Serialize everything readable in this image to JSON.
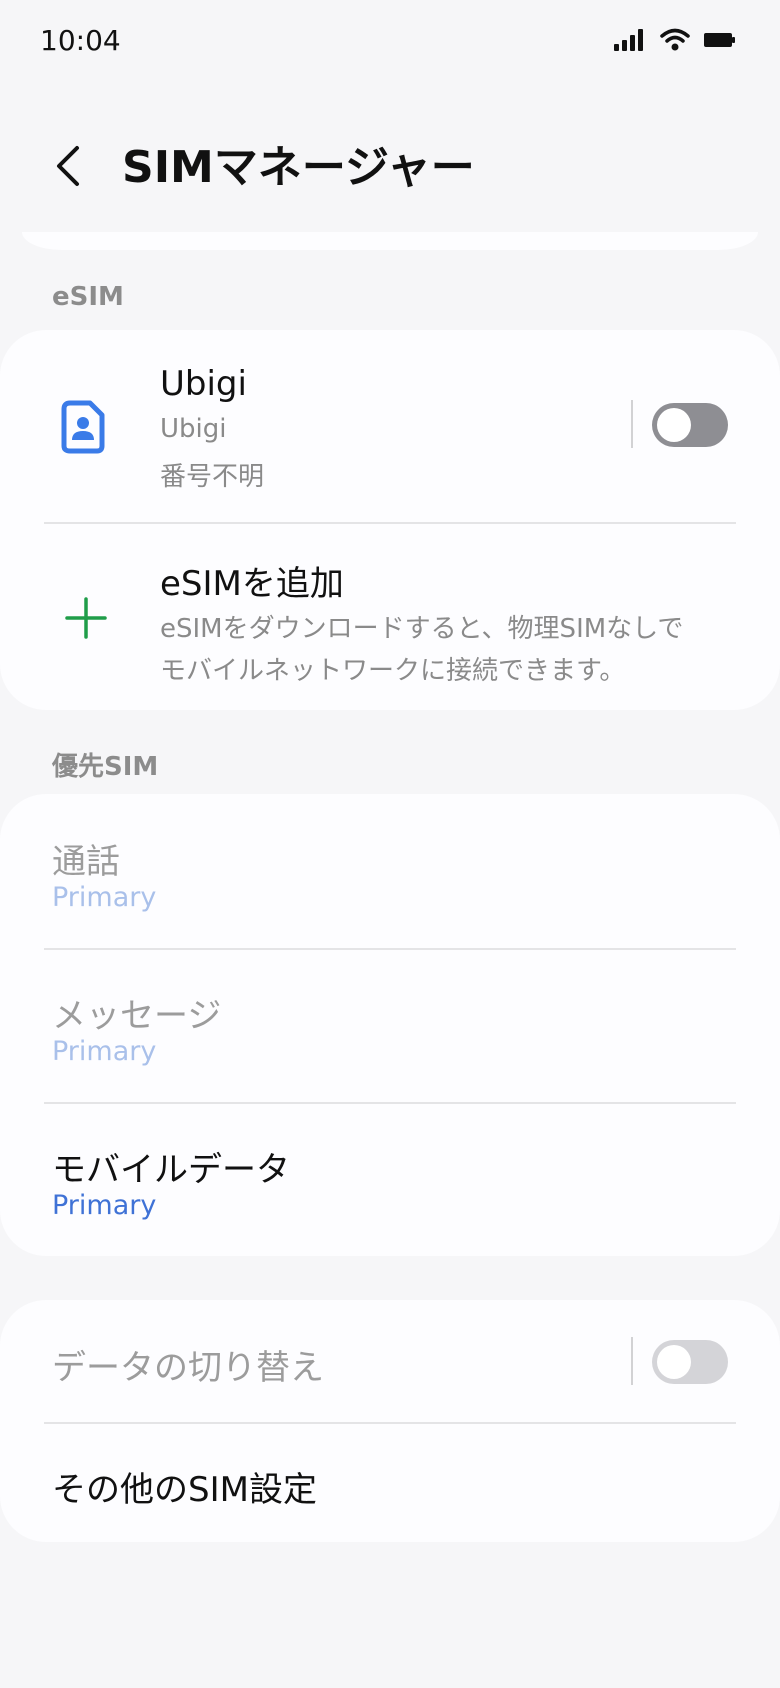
{
  "status_bar": {
    "time": "10:04",
    "icons": [
      "signal-icon",
      "wifi-icon",
      "battery-icon"
    ]
  },
  "header": {
    "title": "SIMマネージャー",
    "back_icon": "chevron-left-icon"
  },
  "esim_section": {
    "label": "eSIM",
    "sim": {
      "title": "Ubigi",
      "carrier": "Ubigi",
      "number": "番号不明",
      "icon": "sim-card-icon",
      "enabled": false
    },
    "add": {
      "title": "eSIMを追加",
      "description_line1": "eSIMをダウンロードすると、物理SIMなしで",
      "description_line2": "モバイルネットワークに接続できます。",
      "icon": "plus-icon"
    }
  },
  "preferred_section": {
    "label": "優先SIM",
    "items": [
      {
        "title": "通話",
        "value": "Primary",
        "enabled": false
      },
      {
        "title": "メッセージ",
        "value": "Primary",
        "enabled": false
      },
      {
        "title": "モバイルデータ",
        "value": "Primary",
        "enabled": true
      }
    ]
  },
  "other_section": {
    "data_switch": {
      "title": "データの切り替え",
      "enabled": false,
      "on": false
    },
    "more_settings": {
      "title": "その他のSIM設定"
    }
  },
  "colors": {
    "background": "#f6f6f8",
    "card": "#fdfdff",
    "accent_blue": "#3f72d6",
    "accent_blue_disabled": "#a9c0ea",
    "plus_green": "#1f9d49",
    "sim_icon_blue": "#3a7be8",
    "toggle_off": "#8e8e93",
    "toggle_disabled": "#d4d4d8",
    "disabled_text": "#9c9c9c"
  }
}
